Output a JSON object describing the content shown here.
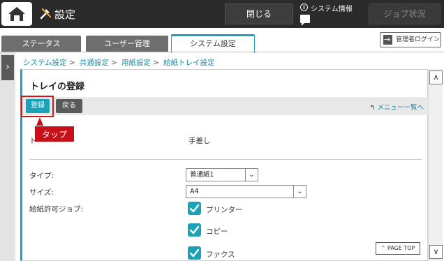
{
  "header": {
    "title": "設定",
    "close_label": "閉じる",
    "system_info_label": "システム情報",
    "job_status_label": "ジョブ状況"
  },
  "tabs": [
    {
      "label": "ステータス",
      "active": false
    },
    {
      "label": "ユーザー管理",
      "active": false
    },
    {
      "label": "システム設定",
      "active": true
    }
  ],
  "admin_login_label": "管理者ログイン",
  "breadcrumb": [
    "システム設定",
    "共通設定",
    "用紙設定",
    "給紙トレイ設定"
  ],
  "panel": {
    "title": "トレイの登録",
    "register_label": "登録",
    "back_label": "戻る",
    "menu_link_label": "メニュー一覧へ"
  },
  "callout": {
    "label": "タップ"
  },
  "form": {
    "tray_label": "ト",
    "tray_value": "手差し",
    "type_label": "タイプ:",
    "type_value": "普通紙1",
    "size_label": "サイズ:",
    "size_value": "A4",
    "allowed_jobs_label": "給紙許可ジョブ:",
    "jobs": [
      {
        "label": "プリンター",
        "checked": true
      },
      {
        "label": "コピー",
        "checked": true
      },
      {
        "label": "ファクス",
        "checked": true
      }
    ]
  },
  "page_top_label": "PAGE TOP",
  "colors": {
    "accent": "#1aa3b8",
    "callout": "#c8101a",
    "header_bg": "#2b2b2b"
  }
}
